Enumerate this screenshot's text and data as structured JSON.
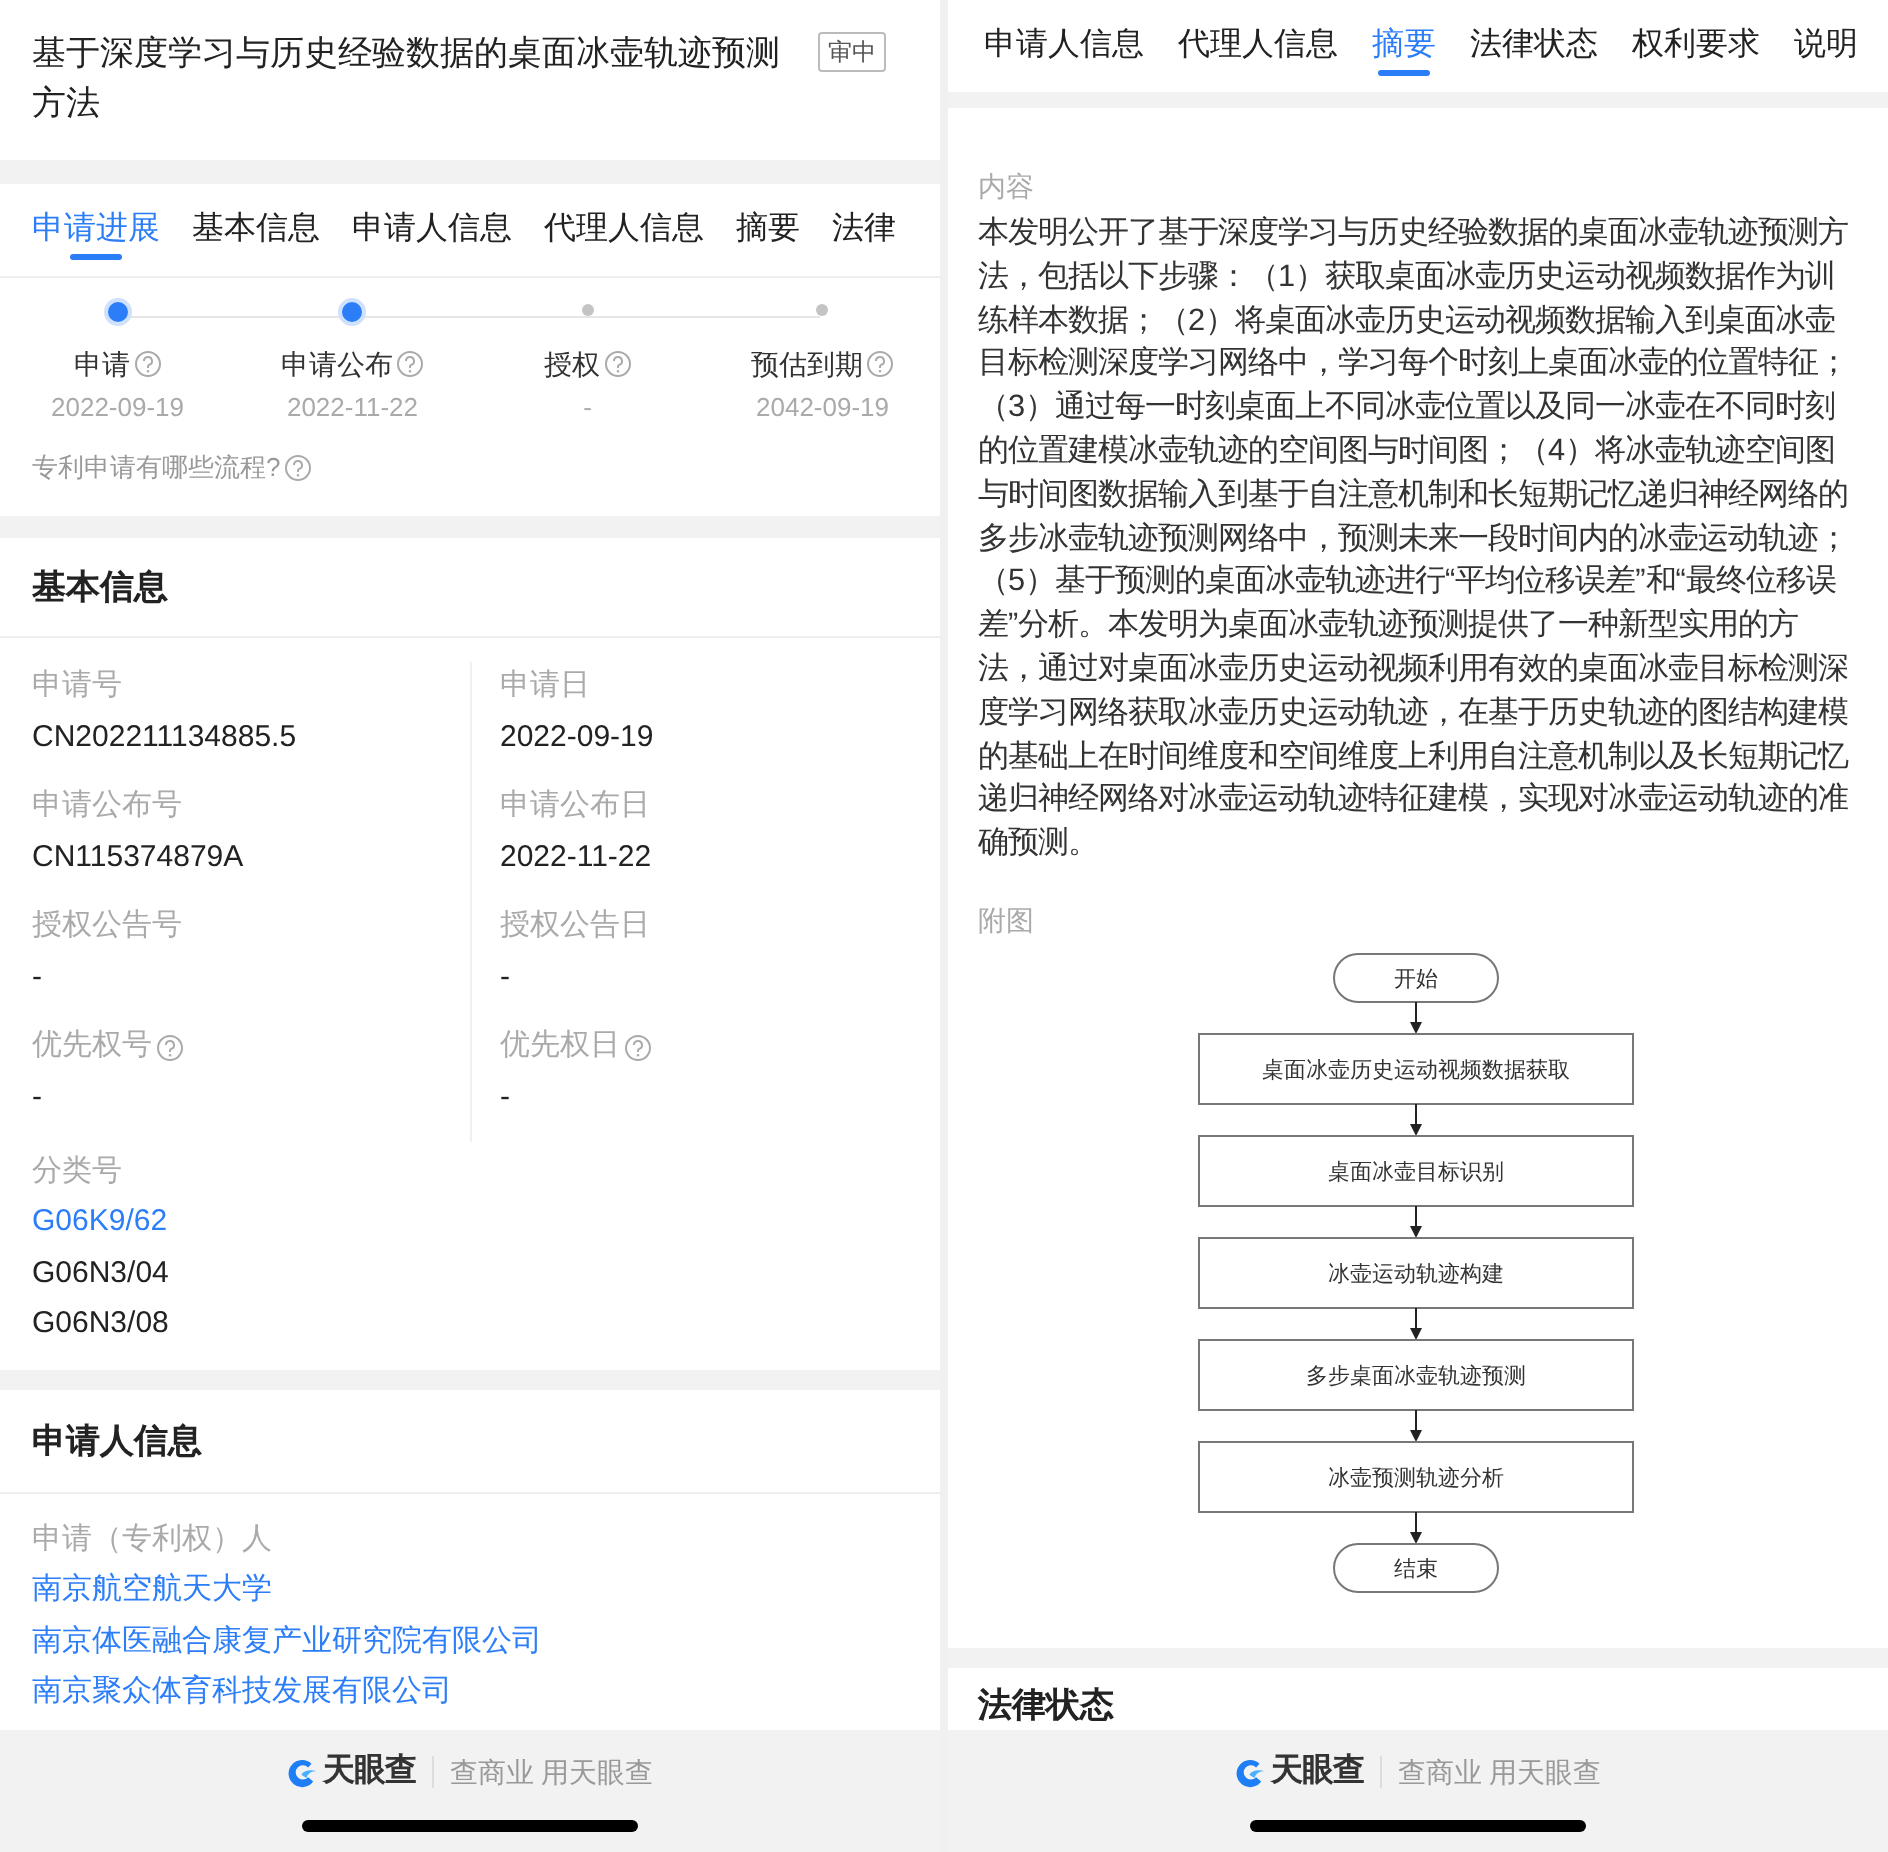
{
  "left": {
    "title": "基于深度学习与历史经验数据的桌面冰壶轨迹预测方法",
    "status_badge": "审中",
    "tabs": [
      {
        "label": "申请进展",
        "selected": true
      },
      {
        "label": "基本信息",
        "selected": false
      },
      {
        "label": "申请人信息",
        "selected": false
      },
      {
        "label": "代理人信息",
        "selected": false
      },
      {
        "label": "摘要",
        "selected": false
      },
      {
        "label": "法律",
        "selected": false
      }
    ],
    "progress": {
      "steps": [
        {
          "label": "申请",
          "date": "2022-09-19",
          "reached": true
        },
        {
          "label": "申请公布",
          "date": "2022-11-22",
          "reached": true
        },
        {
          "label": "授权",
          "date": "-",
          "reached": false
        },
        {
          "label": "预估到期",
          "date": "2042-09-19",
          "reached": false
        }
      ],
      "help_link": "专利申请有哪些流程?"
    },
    "basic_info": {
      "heading": "基本信息",
      "fields": [
        {
          "label": "申请号",
          "value": "CN202211134885.5",
          "help": false
        },
        {
          "label": "申请日",
          "value": "2022-09-19",
          "help": false
        },
        {
          "label": "申请公布号",
          "value": "CN115374879A",
          "help": false
        },
        {
          "label": "申请公布日",
          "value": "2022-11-22",
          "help": false
        },
        {
          "label": "授权公告号",
          "value": "-",
          "help": false
        },
        {
          "label": "授权公告日",
          "value": "-",
          "help": false
        },
        {
          "label": "优先权号",
          "value": "-",
          "help": true
        },
        {
          "label": "优先权日",
          "value": "-",
          "help": true
        }
      ],
      "classification": {
        "label": "分类号",
        "codes": [
          {
            "code": "G06K9/62",
            "link": true
          },
          {
            "code": "G06N3/04",
            "link": false
          },
          {
            "code": "G06N3/08",
            "link": false
          }
        ]
      }
    },
    "applicants": {
      "heading": "申请人信息",
      "label": "申请（专利权）人",
      "names": [
        "南京航空航天大学",
        "南京体医融合康复产业研究院有限公司",
        "南京聚众体育科技发展有限公司"
      ]
    },
    "footer": {
      "brand": "天眼查",
      "slogan": "查商业 用天眼查"
    }
  },
  "right": {
    "tabs": [
      {
        "label": "申请人信息",
        "selected": false
      },
      {
        "label": "代理人信息",
        "selected": false
      },
      {
        "label": "摘要",
        "selected": true
      },
      {
        "label": "法律状态",
        "selected": false
      },
      {
        "label": "权利要求",
        "selected": false
      },
      {
        "label": "说明",
        "selected": false
      }
    ],
    "abstract": {
      "label": "内容",
      "text": "本发明公开了基于深度学习与历史经验数据的桌面冰壶轨迹预测方法，包括以下步骤：（1）获取桌面冰壶历史运动视频数据作为训练样本数据；（2）将桌面冰壶历史运动视频数据输入到桌面冰壶目标检测深度学习网络中，学习每个时刻上桌面冰壶的位置特征；（3）通过每一时刻桌面上不同冰壶位置以及同一冰壶在不同时刻的位置建模冰壶轨迹的空间图与时间图；（4）将冰壶轨迹空间图与时间图数据输入到基于自注意机制和长短期记忆递归神经网络的多步冰壶轨迹预测网络中，预测未来一段时间内的冰壶运动轨迹；（5）基于预测的桌面冰壶轨迹进行“平均位移误差”和“最终位移误差”分析。本发明为桌面冰壶轨迹预测提供了一种新型实用的方法，通过对桌面冰壶历史运动视频利用有效的桌面冰壶目标检测深度学习网络获取冰壶历史运动轨迹，在基于历史轨迹的图结构建模的基础上在时间维度和空间维度上利用自注意机制以及长短期记忆递归神经网络对冰壶运动轨迹特征建模，实现对冰壶运动轨迹的准确预测。"
    },
    "figure": {
      "label": "附图",
      "steps": [
        {
          "kind": "terminal",
          "text": "开始"
        },
        {
          "kind": "process",
          "text": "桌面冰壶历史运动视频数据获取"
        },
        {
          "kind": "process",
          "text": "桌面冰壶目标识别"
        },
        {
          "kind": "process",
          "text": "冰壶运动轨迹构建"
        },
        {
          "kind": "process",
          "text": "多步桌面冰壶轨迹预测"
        },
        {
          "kind": "process",
          "text": "冰壶预测轨迹分析"
        },
        {
          "kind": "terminal",
          "text": "结束"
        }
      ]
    },
    "next_section": "法律状态",
    "footer": {
      "brand": "天眼查",
      "slogan": "查商业 用天眼查"
    }
  }
}
